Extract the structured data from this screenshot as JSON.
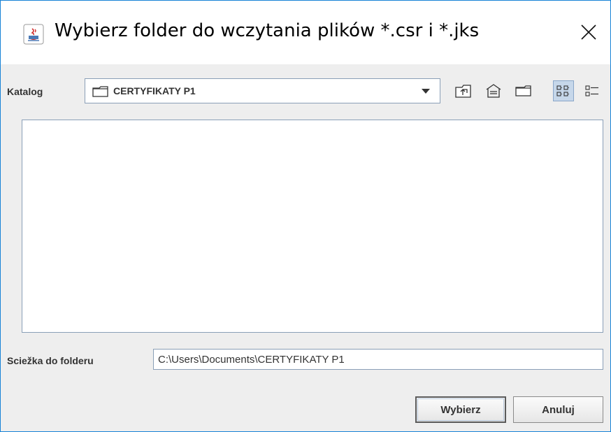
{
  "window": {
    "title": "Wybierz folder do wczytania plików *.csr i *.jks",
    "app_icon": "java-icon",
    "close_icon": "close-icon"
  },
  "location": {
    "label": "Katalog",
    "current_folder": "CERTYFIKATY P1",
    "folder_icon": "folder-icon",
    "dropdown_icon": "chevron-down-icon"
  },
  "toolbar": {
    "buttons": [
      {
        "icon": "up-one-level-icon"
      },
      {
        "icon": "home-icon"
      },
      {
        "icon": "new-folder-icon"
      },
      {
        "icon": "list-view-icon",
        "selected": true
      },
      {
        "icon": "details-view-icon",
        "selected": false
      }
    ]
  },
  "file_list": {
    "items": []
  },
  "path": {
    "label": "Sciežka do folderu",
    "value": "C:\\Users\\Documents\\CERTYFIKATY P1"
  },
  "actions": {
    "confirm_label": "Wybierz",
    "cancel_label": "Anuluj"
  },
  "colors": {
    "window_border": "#1883d7",
    "dialog_background": "#eeeeee",
    "field_border": "#8a9fb7",
    "toggle_selected": "#c6d7ea"
  }
}
